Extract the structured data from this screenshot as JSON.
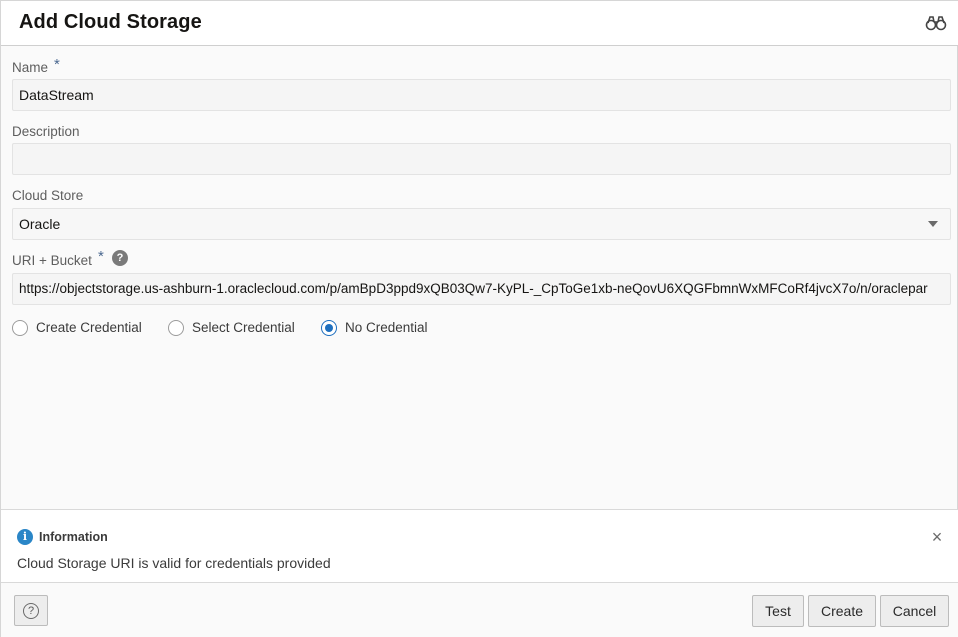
{
  "dialog": {
    "title": "Add Cloud Storage",
    "icons": {
      "header": "binoculars-icon"
    }
  },
  "form": {
    "name": {
      "label": "Name",
      "required": "*",
      "value": "DataStream"
    },
    "description": {
      "label": "Description",
      "value": ""
    },
    "cloud_store": {
      "label": "Cloud Store",
      "value": "Oracle"
    },
    "uri": {
      "label": "URI + Bucket",
      "required": "*",
      "help": "?",
      "value": "https://objectstorage.us-ashburn-1.oraclecloud.com/p/amBpD3ppd9xQB03Qw7-KyPL-_CpToGe1xb-neQovU6XQGFbmnWxMFCoRf4jvcX7o/n/oraclepar"
    },
    "credential_options": [
      {
        "label": "Create Credential",
        "selected": false
      },
      {
        "label": "Select Credential",
        "selected": false
      },
      {
        "label": "No Credential",
        "selected": true
      }
    ]
  },
  "info": {
    "icon": "i",
    "title": "Information",
    "message": "Cloud Storage URI is valid for credentials provided",
    "close": "×"
  },
  "footer": {
    "help_label": "?",
    "test_label": "Test",
    "create_label": "Create",
    "cancel_label": "Cancel"
  },
  "colors": {
    "accent": "#1e6fbf",
    "info": "#2a86c7"
  }
}
